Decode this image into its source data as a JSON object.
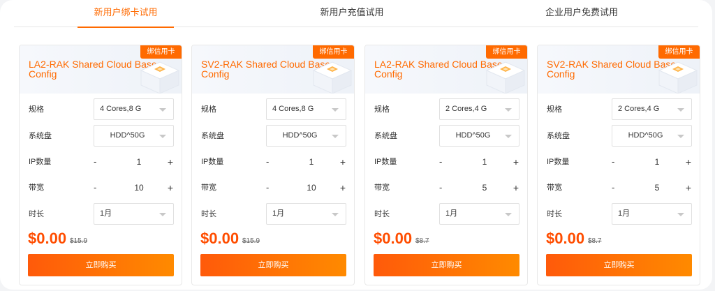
{
  "tabs": [
    {
      "label": "新用户绑卡试用",
      "active": true
    },
    {
      "label": "新用户充值试用",
      "active": false
    },
    {
      "label": "企业用户免费试用",
      "active": false
    }
  ],
  "labels": {
    "spec": "规格",
    "disk": "系统盘",
    "ip": "IP数量",
    "bandwidth": "带宽",
    "duration": "时长",
    "minus": "-",
    "plus": "+"
  },
  "colors": {
    "accent": "#ff6a00",
    "price": "#ff4d00"
  },
  "icons": {
    "select_arrow": "chevron-down-icon",
    "header_art": "cube-illustration"
  },
  "cards": [
    {
      "badge": "绑信用卡",
      "title": "LA2-RAK Shared Cloud Base Config",
      "spec": "4 Cores,8 G",
      "disk": "HDD^50G",
      "ip": "1",
      "bandwidth": "10",
      "duration": "1月",
      "price": "$0.00",
      "old_price": "$15.9",
      "buy_label": "立即购买"
    },
    {
      "badge": "绑信用卡",
      "title": "SV2-RAK Shared Cloud Base Config",
      "spec": "4 Cores,8 G",
      "disk": "HDD^50G",
      "ip": "1",
      "bandwidth": "10",
      "duration": "1月",
      "price": "$0.00",
      "old_price": "$15.9",
      "buy_label": "立即购买"
    },
    {
      "badge": "绑信用卡",
      "title": "LA2-RAK Shared Cloud Base Config",
      "spec": "2 Cores,4 G",
      "disk": "HDD^50G",
      "ip": "1",
      "bandwidth": "5",
      "duration": "1月",
      "price": "$0.00",
      "old_price": "$8.7",
      "buy_label": "立即购买"
    },
    {
      "badge": "绑信用卡",
      "title": "SV2-RAK Shared Cloud Base Config",
      "spec": "2 Cores,4 G",
      "disk": "HDD^50G",
      "ip": "1",
      "bandwidth": "5",
      "duration": "1月",
      "price": "$0.00",
      "old_price": "$8.7",
      "buy_label": "立即购买"
    }
  ]
}
